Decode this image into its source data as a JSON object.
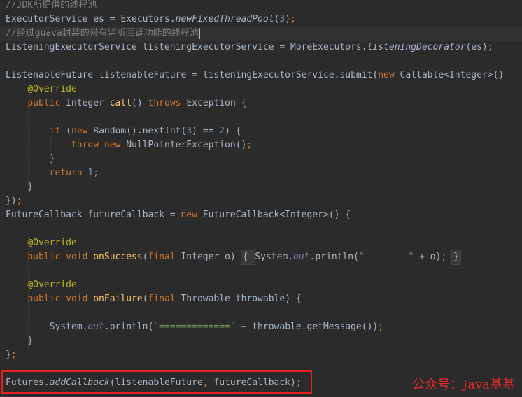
{
  "editor": {
    "lines": [
      {
        "tokens": [
          {
            "t": "//JDK所提供的线程池",
            "c": "c"
          }
        ]
      },
      {
        "tokens": [
          {
            "t": "ExecutorService es = Executors.",
            "c": "p"
          },
          {
            "t": "newFixedThreadPool",
            "c": "i"
          },
          {
            "t": "(",
            "c": "p"
          },
          {
            "t": "3",
            "c": "n"
          },
          {
            "t": ")",
            "c": "p"
          },
          {
            "t": ";",
            "c": "k"
          }
        ]
      },
      {
        "current": true,
        "tokens": [
          {
            "t": "//经过guava封装的带有监听回调功能的线程池",
            "c": "c"
          }
        ]
      },
      {
        "tokens": [
          {
            "t": "ListeningExecutorService listeningExecutorService = MoreExecutors.",
            "c": "p"
          },
          {
            "t": "listeningDecorator",
            "c": "i"
          },
          {
            "t": "(es)",
            "c": "p"
          },
          {
            "t": ";",
            "c": "k"
          }
        ]
      },
      {
        "tokens": []
      },
      {
        "tokens": [
          {
            "t": "ListenableFuture listenableFuture = listeningExecutorService.submit(",
            "c": "p"
          },
          {
            "t": "new ",
            "c": "k"
          },
          {
            "t": "Callable<Integer>()",
            "c": "p"
          }
        ]
      },
      {
        "tokens": [
          {
            "t": "    ",
            "c": "p"
          },
          {
            "t": "@Override",
            "c": "a"
          }
        ]
      },
      {
        "tokens": [
          {
            "t": "    ",
            "c": "p"
          },
          {
            "t": "public ",
            "c": "k"
          },
          {
            "t": "Integer ",
            "c": "p"
          },
          {
            "t": "call",
            "c": "m"
          },
          {
            "t": "() ",
            "c": "p"
          },
          {
            "t": "throws ",
            "c": "k"
          },
          {
            "t": "Exception {",
            "c": "p"
          }
        ]
      },
      {
        "tokens": []
      },
      {
        "tokens": [
          {
            "t": "        ",
            "c": "p"
          },
          {
            "t": "if ",
            "c": "k"
          },
          {
            "t": "(",
            "c": "p"
          },
          {
            "t": "new ",
            "c": "k"
          },
          {
            "t": "Random().nextInt(",
            "c": "p"
          },
          {
            "t": "3",
            "c": "n"
          },
          {
            "t": ") == ",
            "c": "p"
          },
          {
            "t": "2",
            "c": "n"
          },
          {
            "t": ") {",
            "c": "p"
          }
        ]
      },
      {
        "tokens": [
          {
            "t": "            ",
            "c": "p"
          },
          {
            "t": "throw new ",
            "c": "k"
          },
          {
            "t": "NullPointerException()",
            "c": "p"
          },
          {
            "t": ";",
            "c": "k"
          }
        ]
      },
      {
        "tokens": [
          {
            "t": "        }",
            "c": "p"
          }
        ]
      },
      {
        "tokens": [
          {
            "t": "        ",
            "c": "p"
          },
          {
            "t": "return ",
            "c": "k"
          },
          {
            "t": "1",
            "c": "n"
          },
          {
            "t": ";",
            "c": "k"
          }
        ]
      },
      {
        "tokens": [
          {
            "t": "    }",
            "c": "p"
          }
        ]
      },
      {
        "tokens": [
          {
            "t": "})",
            "c": "p"
          },
          {
            "t": ";",
            "c": "k"
          }
        ]
      },
      {
        "tokens": [
          {
            "t": "FutureCallback futureCallback = ",
            "c": "p"
          },
          {
            "t": "new ",
            "c": "k"
          },
          {
            "t": "FutureCallback<Integer>() {",
            "c": "p"
          }
        ]
      },
      {
        "tokens": []
      },
      {
        "tokens": [
          {
            "t": "    ",
            "c": "p"
          },
          {
            "t": "@Override",
            "c": "a"
          }
        ]
      },
      {
        "tokens": [
          {
            "t": "    ",
            "c": "p"
          },
          {
            "t": "public void ",
            "c": "k"
          },
          {
            "t": "onSuccess",
            "c": "m"
          },
          {
            "t": "(",
            "c": "p"
          },
          {
            "t": "final ",
            "c": "k"
          },
          {
            "t": "Integer o) ",
            "c": "p"
          },
          {
            "t": "{ ",
            "c": "fold"
          },
          {
            "t": "System.",
            "c": "p"
          },
          {
            "t": "out",
            "c": "f"
          },
          {
            "t": ".println(",
            "c": "p"
          },
          {
            "t": "\"--------\"",
            "c": "s"
          },
          {
            "t": " + o)",
            "c": "p"
          },
          {
            "t": ";",
            "c": "k"
          },
          {
            "t": " ",
            "c": "p"
          },
          {
            "t": "}",
            "c": "fold"
          }
        ]
      },
      {
        "tokens": []
      },
      {
        "tokens": [
          {
            "t": "    ",
            "c": "p"
          },
          {
            "t": "@Override",
            "c": "a"
          }
        ]
      },
      {
        "tokens": [
          {
            "t": "    ",
            "c": "p"
          },
          {
            "t": "public void ",
            "c": "k"
          },
          {
            "t": "onFailure",
            "c": "m"
          },
          {
            "t": "(",
            "c": "p"
          },
          {
            "t": "final ",
            "c": "k"
          },
          {
            "t": "Throwable throwable) {",
            "c": "p"
          }
        ]
      },
      {
        "tokens": []
      },
      {
        "tokens": [
          {
            "t": "        System.",
            "c": "p"
          },
          {
            "t": "out",
            "c": "f"
          },
          {
            "t": ".println(",
            "c": "p"
          },
          {
            "t": "\"=============\"",
            "c": "s"
          },
          {
            "t": " + throwable.getMessage())",
            "c": "p"
          },
          {
            "t": ";",
            "c": "k"
          }
        ]
      },
      {
        "tokens": [
          {
            "t": "    }",
            "c": "p"
          }
        ]
      },
      {
        "tokens": [
          {
            "t": "}",
            "c": "p"
          },
          {
            "t": ";",
            "c": "k"
          }
        ]
      },
      {
        "tokens": []
      },
      {
        "tokens": [
          {
            "t": "Futures.",
            "c": "p"
          },
          {
            "t": "addCallback",
            "c": "i"
          },
          {
            "t": "(listenableFuture",
            "c": "p"
          },
          {
            "t": ", ",
            "c": "k"
          },
          {
            "t": "futureCallback)",
            "c": "p"
          },
          {
            "t": ";",
            "c": "k"
          }
        ]
      }
    ]
  },
  "watermark": "公众号：Java基基",
  "colors": {
    "background": "#2b2b2b",
    "text": "#a9b7c6",
    "keyword": "#cc7832",
    "comment": "#808080",
    "number": "#6897bb",
    "string": "#6a8759",
    "annotation": "#bbb529",
    "method": "#ffc66d",
    "field": "#9876aa",
    "highlight_box": "#e62020"
  }
}
